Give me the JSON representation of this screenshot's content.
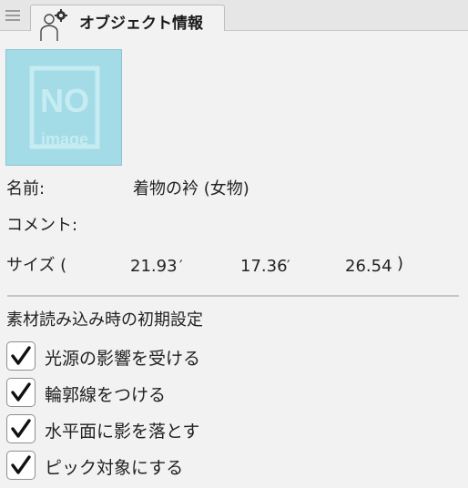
{
  "panel": {
    "tab_title": "オブジェクト情報"
  },
  "thumbnail": {
    "text_line1": "NO",
    "text_line2": "image",
    "bg_color": "#a3dbe6"
  },
  "fields": {
    "name_label": "名前:",
    "name_value": "着物の衿 (女物)",
    "comment_label": "コメント:",
    "size_label": "サイズ (",
    "size_x": "21.93",
    "size_y": "17.36",
    "size_z": "26.54",
    "size_close": ")"
  },
  "initial_settings": {
    "heading": "素材読み込み時の初期設定",
    "options": [
      {
        "label": "光源の影響を受ける",
        "checked": true
      },
      {
        "label": "輪郭線をつける",
        "checked": true
      },
      {
        "label": "水平面に影を落とす",
        "checked": true
      },
      {
        "label": "ピック対象にする",
        "checked": true
      }
    ]
  }
}
